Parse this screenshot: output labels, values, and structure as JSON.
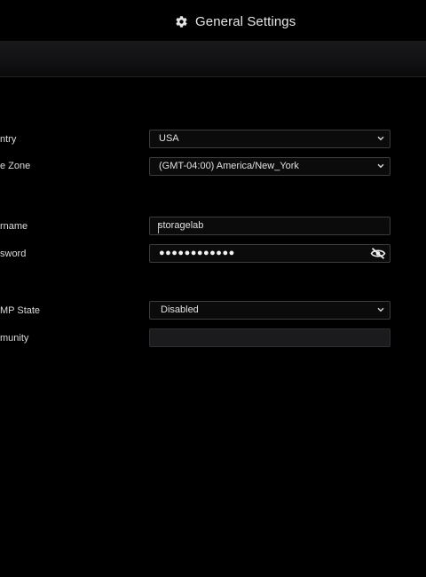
{
  "header": {
    "title": "General Settings",
    "icon": "gear-icon"
  },
  "fields": {
    "country": {
      "label": "ntry",
      "value": "USA"
    },
    "timezone": {
      "label": "e Zone",
      "value": "(GMT-04:00) America/New_York"
    },
    "username": {
      "label": "rname",
      "value": "storagelab"
    },
    "password": {
      "label": "sword",
      "value": "●●●●●●●●●●●●"
    },
    "snmp_state": {
      "label": "MP State",
      "value": "Disabled"
    },
    "community": {
      "label": "munity",
      "value": ""
    }
  },
  "colors": {
    "background": "#000000",
    "field_border": "#3c3c3f",
    "text": "#e0e0e0"
  }
}
